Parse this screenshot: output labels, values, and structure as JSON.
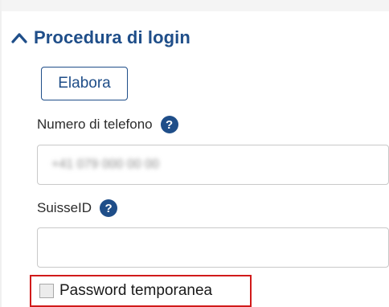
{
  "section": {
    "title": "Procedura di login",
    "toggle_icon": "chevron-up-icon"
  },
  "actions": {
    "elabora_label": "Elabora"
  },
  "fields": {
    "phone": {
      "label": "Numero di telefono",
      "help_icon": "?",
      "value": "+41 079 000 00 00"
    },
    "suisseid": {
      "label": "SuisseID",
      "help_icon": "?",
      "value": ""
    }
  },
  "options": {
    "temp_password_label": "Password temporanea",
    "temp_password_checked": false
  },
  "colors": {
    "accent": "#1f4e89",
    "highlight": "#d11a1a"
  }
}
